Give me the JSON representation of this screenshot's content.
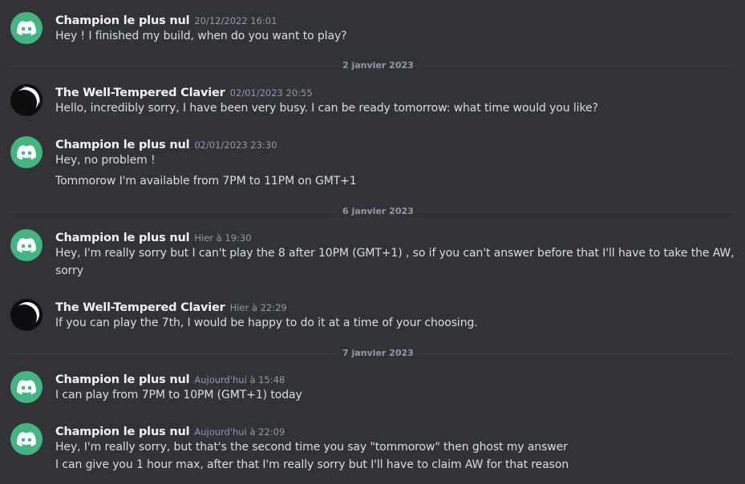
{
  "messages": [
    {
      "author": "Champion le plus nul",
      "timestamp": "20/12/2022 16:01",
      "avatar_icon": "discord-logo-icon",
      "lines": [
        "Hey ! I finished my build, when do you want to play?"
      ]
    },
    {
      "author": "The Well-Tempered Clavier",
      "timestamp": "02/01/2023 20:55",
      "avatar_icon": "moon-avatar-icon",
      "lines": [
        "Hello, incredibly sorry, I have been very busy. I can be ready tomorrow: what time would you like?"
      ]
    },
    {
      "author": "Champion le plus nul",
      "timestamp": "02/01/2023 23:30",
      "avatar_icon": "discord-logo-icon",
      "lines": [
        "Hey, no problem !",
        "Tommorow I'm available from 7PM to 11PM on GMT+1"
      ]
    },
    {
      "author": "Champion le plus nul",
      "timestamp": "Hier à 19:30",
      "avatar_icon": "discord-logo-icon",
      "lines": [
        "Hey, I'm really sorry but I can't play the 8 after 10PM (GMT+1) , so if you can't answer before that I'll have to take the AW,",
        "sorry"
      ]
    },
    {
      "author": "The Well-Tempered Clavier",
      "timestamp": "Hier à 22:29",
      "avatar_icon": "moon-avatar-icon",
      "lines": [
        "If you can play the 7th, I would be happy to do it at a time of your choosing."
      ]
    },
    {
      "author": "Champion le plus nul",
      "timestamp": "Aujourd'hui à 15:48",
      "avatar_icon": "discord-logo-icon",
      "lines": [
        "I can play from 7PM to 10PM (GMT+1) today"
      ]
    },
    {
      "author": "Champion le plus nul",
      "timestamp": "Aujourd'hui à 22:09",
      "avatar_icon": "discord-logo-icon",
      "lines": [
        "Hey, I'm really sorry, but that's the second time you say \"tommorow\" then ghost my answer",
        "I can give you 1 hour max, after that I'm really sorry but I'll have to claim AW for that reason"
      ]
    }
  ],
  "dividers": [
    "2 janvier 2023",
    "6 janvier 2023",
    "7 janvier 2023"
  ],
  "colors": {
    "background": "#313338",
    "discord_avatar": "#43b581",
    "author": "#f2f3f5",
    "text": "#dbdee1",
    "muted": "#949ba4"
  }
}
